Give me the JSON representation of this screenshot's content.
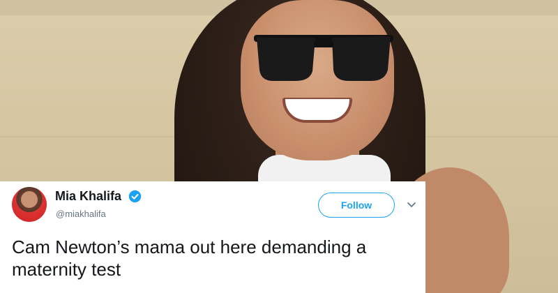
{
  "tweet_card": {
    "display_name": "Mia Khalifa",
    "handle": "@miakhalifa",
    "follow_label": "Follow",
    "text": "Cam Newton’s mama out here demanding a maternity test"
  },
  "colors": {
    "accent": "#1da1f2",
    "text": "#14171a",
    "secondary_text": "#657786"
  },
  "icons": {
    "verified": "verified-badge-icon",
    "menu": "chevron-down-icon"
  }
}
